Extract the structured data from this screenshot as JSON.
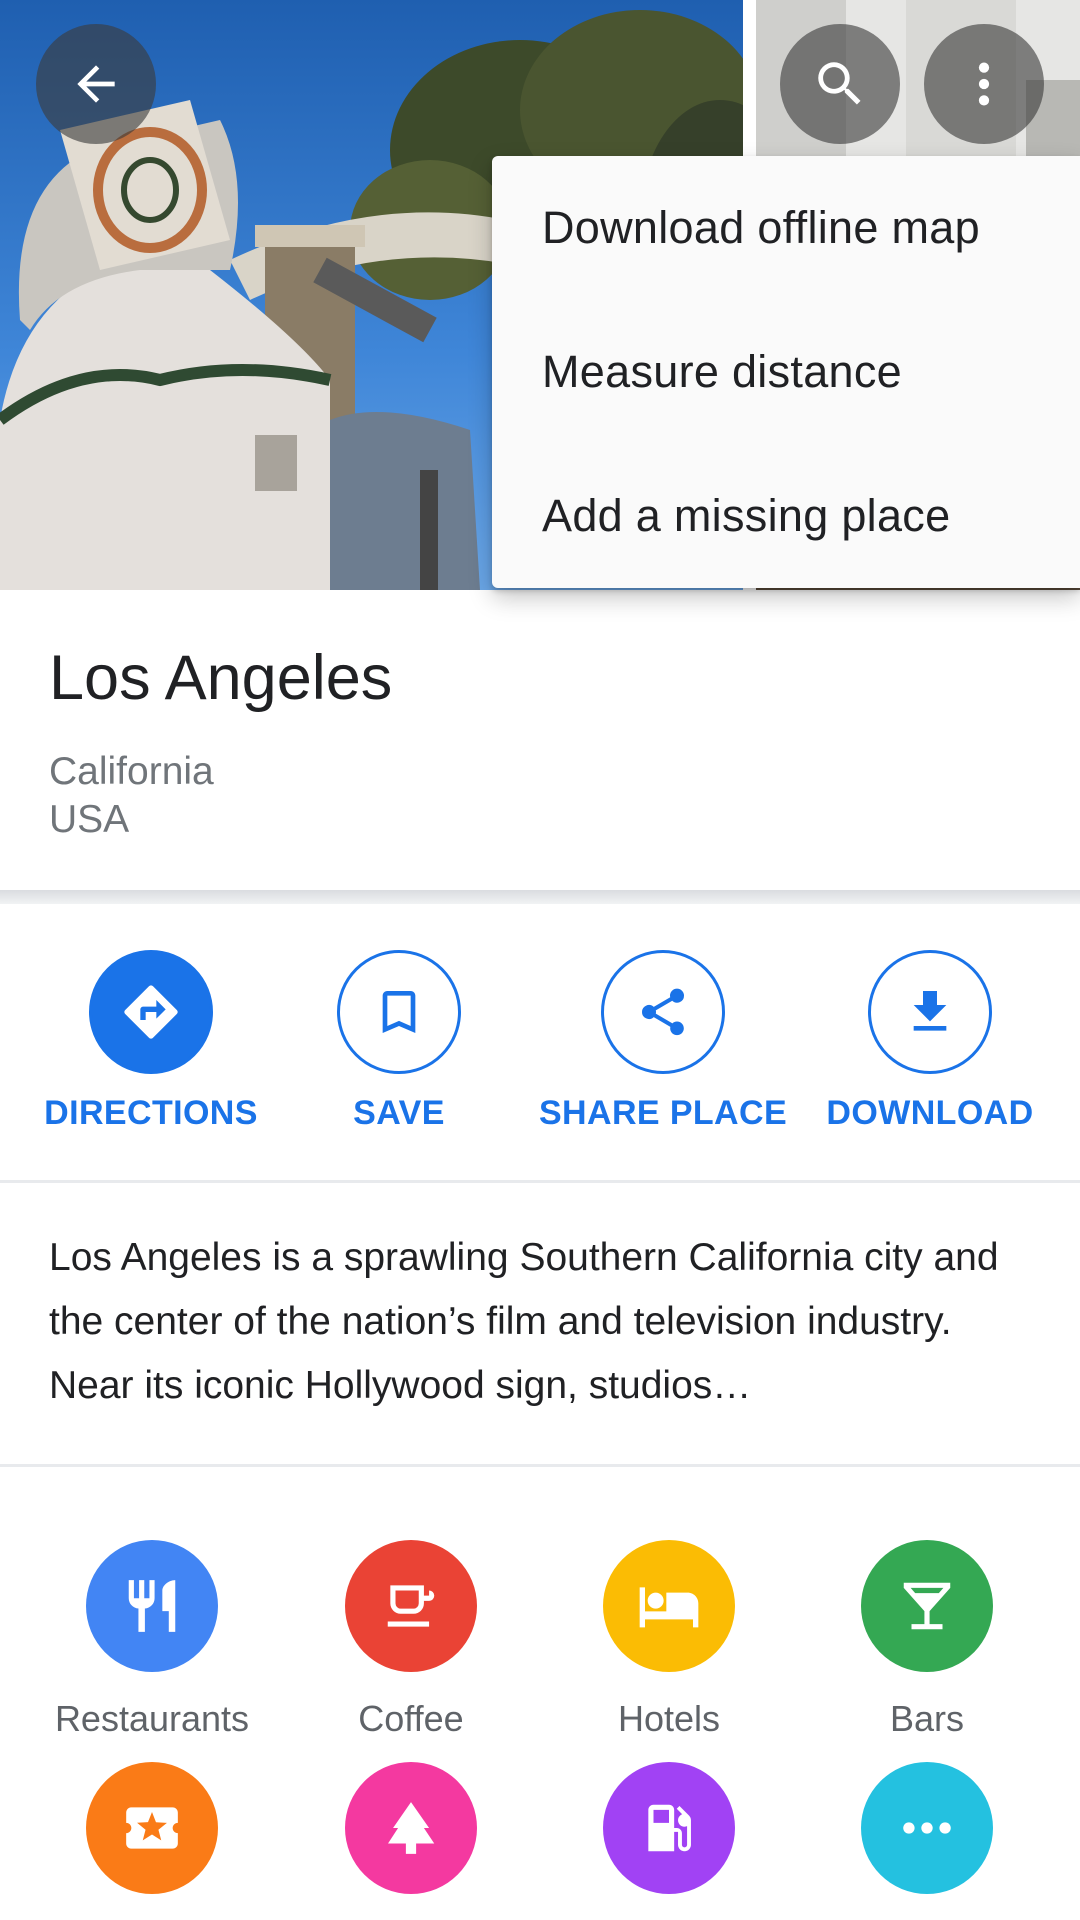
{
  "header": {
    "back_icon": "arrow-back-icon",
    "search_icon": "search-icon",
    "more_icon": "more-vert-icon"
  },
  "menu": {
    "items": [
      {
        "label": "Download offline map"
      },
      {
        "label": "Measure distance"
      },
      {
        "label": "Add a missing place"
      }
    ]
  },
  "place": {
    "title": "Los Angeles",
    "region": "California",
    "country": "USA"
  },
  "actions": [
    {
      "label": "DIRECTIONS",
      "icon": "directions-icon"
    },
    {
      "label": "SAVE",
      "icon": "bookmark-icon"
    },
    {
      "label": "SHARE PLACE",
      "icon": "share-icon"
    },
    {
      "label": "DOWNLOAD",
      "icon": "download-icon"
    }
  ],
  "description": "Los Angeles is a sprawling Southern California city and the center of the nation’s film and television industry. Near its iconic Hollywood sign, studios…",
  "categories": [
    {
      "label": "Restaurants",
      "icon": "restaurant-icon",
      "color": "#4285f4"
    },
    {
      "label": "Coffee",
      "icon": "coffee-icon",
      "color": "#ea4335"
    },
    {
      "label": "Hotels",
      "icon": "hotel-icon",
      "color": "#fbbc04"
    },
    {
      "label": "Bars",
      "icon": "bar-icon",
      "color": "#34a853"
    },
    {
      "label": "",
      "icon": "ticket-icon",
      "color": "#fa7b17"
    },
    {
      "label": "",
      "icon": "park-icon",
      "color": "#f439a0"
    },
    {
      "label": "",
      "icon": "gas-station-icon",
      "color": "#a142f4"
    },
    {
      "label": "",
      "icon": "more-horiz-icon",
      "color": "#24c1e0"
    }
  ],
  "colors": {
    "accent": "#1a73e8",
    "text_primary": "#202124",
    "text_secondary": "#70757a"
  }
}
